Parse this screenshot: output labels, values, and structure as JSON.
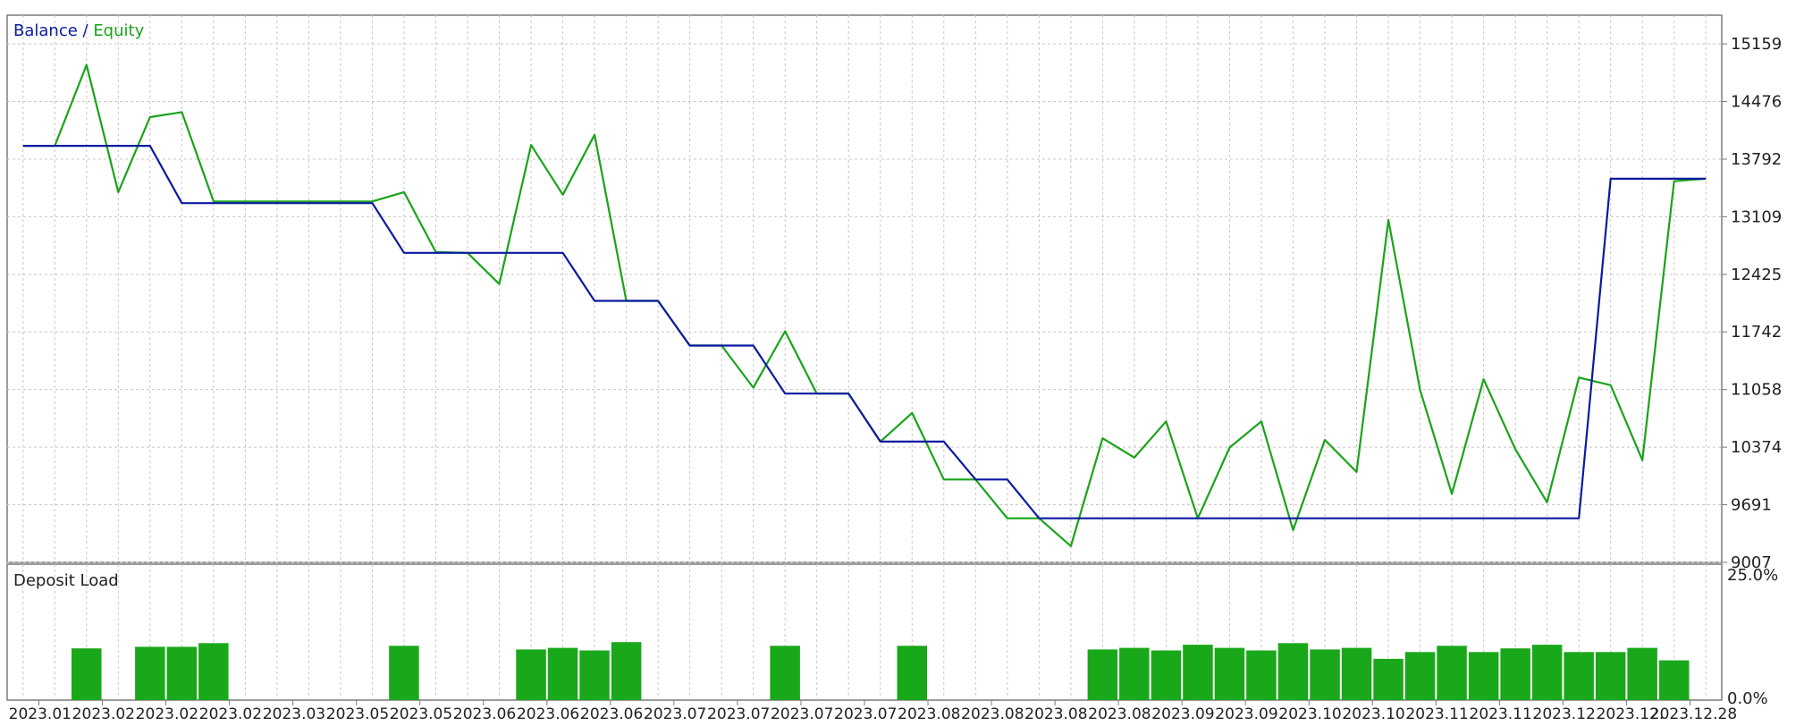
{
  "window": {
    "title": ""
  },
  "colors": {
    "balance": "#0a1aa0",
    "equity": "#1aa31a",
    "bar": "#19a819",
    "frame": "#7a7a7a",
    "grid": "#c8c8c8",
    "text": "#222222"
  },
  "legend": {
    "balance": "Balance",
    "separator": " / ",
    "equity": "Equity"
  },
  "chart_data": [
    {
      "type": "line",
      "legend_position": "top-left",
      "grid": true,
      "ylim": [
        9007,
        15500
      ],
      "yticks": [
        15159,
        14476,
        13792,
        13109,
        12425,
        11742,
        11058,
        10374,
        9691,
        9007
      ],
      "xlim": [
        0,
        53
      ],
      "series": [
        {
          "name": "Balance",
          "x": [
            0,
            4,
            5,
            11,
            12,
            17,
            18,
            20,
            21,
            23,
            24,
            26,
            27,
            29,
            30,
            31,
            32,
            49,
            50,
            53
          ],
          "values": [
            13950,
            13950,
            13270,
            13270,
            12680,
            12680,
            12110,
            12110,
            11580,
            11580,
            11010,
            11010,
            10440,
            10440,
            9990,
            9990,
            9530,
            9530,
            13560,
            13560
          ]
        },
        {
          "name": "Equity",
          "x": [
            0,
            1,
            2,
            3,
            4,
            5,
            6,
            10,
            11,
            12,
            13,
            14,
            15,
            16,
            17,
            18,
            19,
            20,
            21,
            22,
            23,
            24,
            25,
            26,
            27,
            28,
            29,
            30,
            31,
            32,
            33,
            34,
            35,
            36,
            37,
            38,
            39,
            40,
            41,
            42,
            43,
            44,
            45,
            46,
            47,
            48,
            49,
            50,
            51,
            52,
            53
          ],
          "values": [
            13950,
            13950,
            14910,
            13400,
            14290,
            14350,
            13290,
            13290,
            13290,
            13400,
            12690,
            12680,
            12310,
            13960,
            13370,
            14080,
            12110,
            12110,
            11580,
            11580,
            11080,
            11750,
            11010,
            11010,
            10440,
            10780,
            9990,
            9990,
            9530,
            9530,
            9200,
            10480,
            10250,
            10680,
            9530,
            10370,
            10680,
            9390,
            10460,
            10080,
            13070,
            11050,
            9820,
            11180,
            10350,
            9720,
            11200,
            11110,
            10220,
            13530,
            13560
          ]
        }
      ]
    },
    {
      "type": "bar",
      "title": "Deposit Load",
      "ylim": [
        0,
        25
      ],
      "yticks": [
        "25.0%",
        "0.0%"
      ],
      "xticks": [
        "2023.01.",
        "2023.02.",
        "2023.02.",
        "2023.02.",
        "2023.03.",
        "2023.05.",
        "2023.05.",
        "2023.06.",
        "2023.06.",
        "2023.06.",
        "2023.07.",
        "2023.07.",
        "2023.07.",
        "2023.07.",
        "2023.08.",
        "2023.08.",
        "2023.08.",
        "2023.08.",
        "2023.09.",
        "2023.09.",
        "2023.10.",
        "2023.10.",
        "2023.11.",
        "2023.11.",
        "2023.12.",
        "2023.12.",
        "2023.12.28"
      ],
      "bars": [
        {
          "index": 2,
          "value": 9.9
        },
        {
          "index": 4,
          "value": 10.2
        },
        {
          "index": 5,
          "value": 10.2
        },
        {
          "index": 6,
          "value": 10.9
        },
        {
          "index": 12,
          "value": 10.4
        },
        {
          "index": 16,
          "value": 9.7
        },
        {
          "index": 17,
          "value": 10.0
        },
        {
          "index": 18,
          "value": 9.5
        },
        {
          "index": 19,
          "value": 11.1
        },
        {
          "index": 24,
          "value": 10.4
        },
        {
          "index": 28,
          "value": 10.4
        },
        {
          "index": 34,
          "value": 9.7
        },
        {
          "index": 35,
          "value": 10.0
        },
        {
          "index": 36,
          "value": 9.5
        },
        {
          "index": 37,
          "value": 10.6
        },
        {
          "index": 38,
          "value": 10.0
        },
        {
          "index": 39,
          "value": 9.5
        },
        {
          "index": 40,
          "value": 10.9
        },
        {
          "index": 41,
          "value": 9.7
        },
        {
          "index": 42,
          "value": 10.0
        },
        {
          "index": 43,
          "value": 7.9
        },
        {
          "index": 44,
          "value": 9.2
        },
        {
          "index": 45,
          "value": 10.4
        },
        {
          "index": 46,
          "value": 9.2
        },
        {
          "index": 47,
          "value": 9.9
        },
        {
          "index": 48,
          "value": 10.6
        },
        {
          "index": 49,
          "value": 9.2
        },
        {
          "index": 50,
          "value": 9.2
        },
        {
          "index": 51,
          "value": 10.0
        },
        {
          "index": 52,
          "value": 7.6
        }
      ]
    }
  ]
}
